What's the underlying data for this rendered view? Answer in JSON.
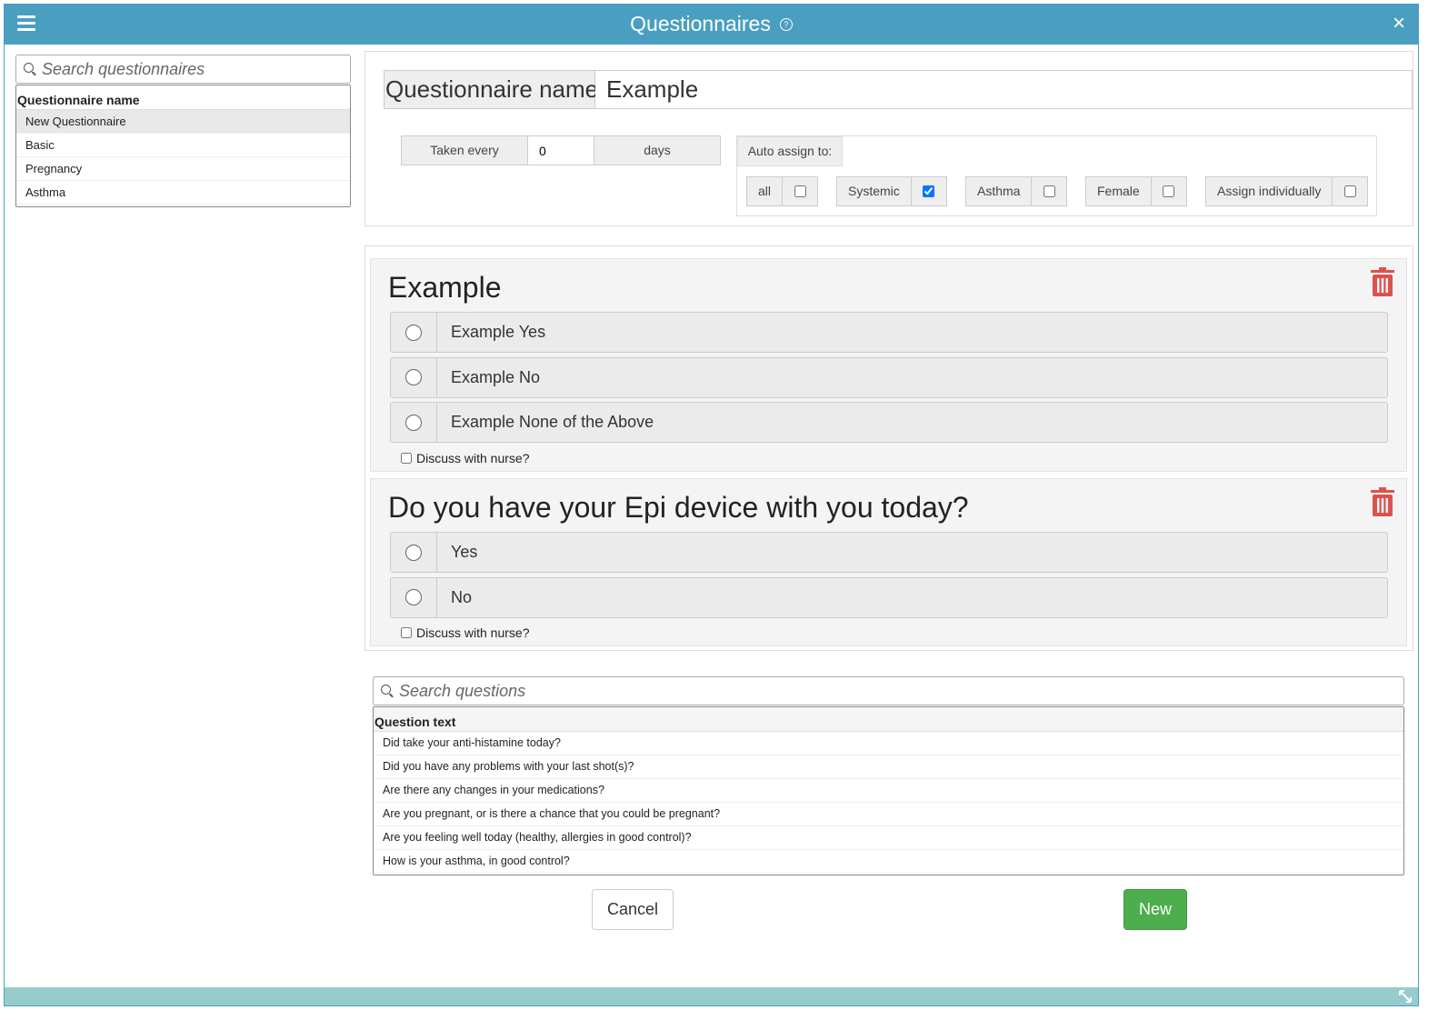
{
  "window": {
    "title": "Questionnaires",
    "help_icon": "question-circle-icon",
    "close_label": "×",
    "menu_icon": "hamburger-icon"
  },
  "sidebar": {
    "search_placeholder": "Search questionnaires",
    "column_header": "Questionnaire name",
    "items": [
      {
        "label": "New Questionnaire",
        "selected": true
      },
      {
        "label": "Basic"
      },
      {
        "label": "Pregnancy"
      },
      {
        "label": "Asthma"
      }
    ]
  },
  "settings": {
    "name_label": "Questionnaire name",
    "name_value": "Example",
    "taken_every_label": "Taken every",
    "taken_every_value": "0",
    "days_label": "days",
    "auto_assign_label": "Auto assign to:",
    "groups": [
      {
        "label": "all",
        "checked": false
      },
      {
        "label": "Systemic",
        "checked": true
      },
      {
        "label": "Asthma",
        "checked": false
      },
      {
        "label": "Female",
        "checked": false
      },
      {
        "label": "Assign individually",
        "checked": false
      }
    ]
  },
  "questions": [
    {
      "title": "Example",
      "options": [
        "Example Yes",
        "Example No",
        "Example None of the Above"
      ],
      "discuss_label": "Discuss with nurse?"
    },
    {
      "title": "Do you have your Epi device with you today?",
      "options": [
        "Yes",
        "No"
      ],
      "discuss_label": "Discuss with nurse?"
    }
  ],
  "question_bank": {
    "search_placeholder": "Search questions",
    "column_header": "Question text",
    "rows": [
      "Did take your anti-histamine today?",
      "Did you have any problems with your last shot(s)?",
      "Are there any changes in your medications?",
      "Are you pregnant, or is there a chance that you could be pregnant?",
      "Are you feeling well today (healthy, allergies in good control)?",
      "How is your asthma, in good control?"
    ]
  },
  "actions": {
    "cancel_label": "Cancel",
    "new_label": "New"
  },
  "colors": {
    "titlebar": "#4a9fc0",
    "statusbar": "#96cccc",
    "trash": "#d9534f",
    "new_button": "#4cae4c",
    "checkbox_checked": "#1a73e8"
  }
}
